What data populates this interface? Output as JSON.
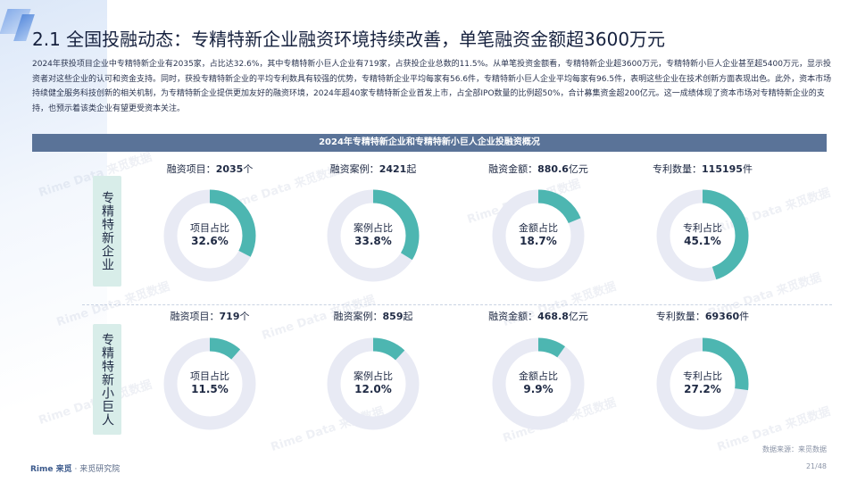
{
  "page": {
    "title": "2.1 全国投融动态：专精特新企业融资环境持续改善，单笔融资金额超3600万元",
    "intro": "2024年获投项目企业中专精特新企业有2035家，占比达32.6%，其中专精特新小巨人企业有719家，占获投企业总数的11.5%。从单笔投资金额看，专精特新企业超3600万元，专精特新小巨人企业甚至超5400万元，显示投资者对这些企业的认可和资金支持。同时，获投专精特新企业的平均专利数具有较强的优势，专精特新企业平均每家有56.6件，专精特新小巨人企业平均每家有96.5件，表明这些企业在技术创新方面表现出色。此外，资本市场持续健全服务科技创新的相关机制，为专精特新企业提供更加友好的融资环境，2024年超40家专精特新企业首发上市，占全部IPO数量的比例超50%，合计募集资金超200亿元。这一成绩体现了资本市场对专精特新企业的支持，也预示着该类企业有望更受资本关注。",
    "panel_title": "2024年专精特新企业和专精特新小巨人企业投融资概况",
    "source": "数据来源：来觅数据",
    "footer_brand": "Rime 来觅",
    "footer_org": " · 来觅研究院",
    "page_number": "21/48",
    "watermark": "Rime Data 来觅数据"
  },
  "colors": {
    "accent": "#4db6b1",
    "track": "#e8eaf4",
    "header": "#5a7398",
    "row_label_bg": "#d8ede9"
  },
  "chart_data": [
    {
      "type": "pie",
      "group": "专精特新企业",
      "items": [
        {
          "label_prefix": "融资项目：",
          "value_text": "2035",
          "unit": "个",
          "center_label": "项目占比",
          "pct_text": "32.6%",
          "pct": 32.6
        },
        {
          "label_prefix": "融资案例：",
          "value_text": "2421",
          "unit": "起",
          "center_label": "案例占比",
          "pct_text": "33.8%",
          "pct": 33.8
        },
        {
          "label_prefix": "融资金额：",
          "value_text": "880.6",
          "unit": "亿元",
          "center_label": "金额占比",
          "pct_text": "18.7%",
          "pct": 18.7
        },
        {
          "label_prefix": "专利数量：",
          "value_text": "115195",
          "unit": "件",
          "center_label": "专利占比",
          "pct_text": "45.1%",
          "pct": 45.1
        }
      ]
    },
    {
      "type": "pie",
      "group": "专精特新小巨人",
      "items": [
        {
          "label_prefix": "融资项目：",
          "value_text": "719",
          "unit": "个",
          "center_label": "项目占比",
          "pct_text": "11.5%",
          "pct": 11.5
        },
        {
          "label_prefix": "融资案例：",
          "value_text": "859",
          "unit": "起",
          "center_label": "案例占比",
          "pct_text": "12.0%",
          "pct": 12.0
        },
        {
          "label_prefix": "融资金额：",
          "value_text": "468.8",
          "unit": "亿元",
          "center_label": "金额占比",
          "pct_text": "9.9%",
          "pct": 9.9
        },
        {
          "label_prefix": "专利数量：",
          "value_text": "69360",
          "unit": "件",
          "center_label": "专利占比",
          "pct_text": "27.2%",
          "pct": 27.2
        }
      ]
    }
  ]
}
